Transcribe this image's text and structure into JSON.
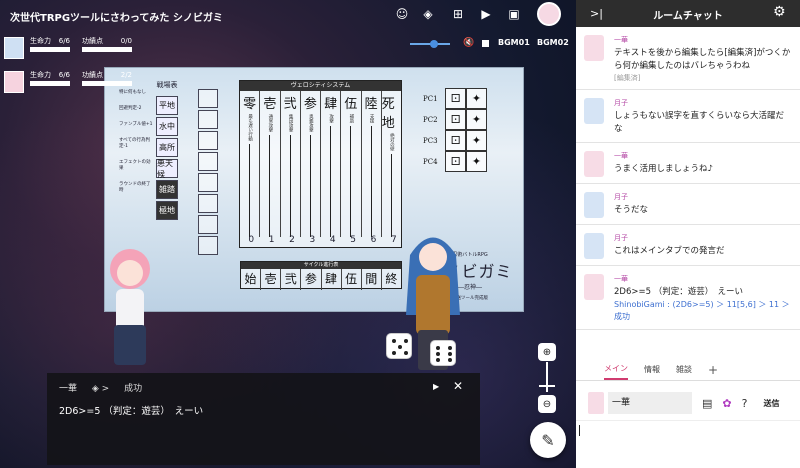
{
  "room": {
    "title": "次世代TRPGツールにさわってみた シノビガミ"
  },
  "statuses": [
    {
      "label1": "生命力",
      "value1": "6/6",
      "label2": "功績点",
      "value2": "0/0"
    },
    {
      "label1": "生命力",
      "value1": "6/6",
      "label2": "功績点",
      "value2": "2/2"
    }
  ],
  "bgm": {
    "track1": "BGM01",
    "track2": "BGM02"
  },
  "board": {
    "terrain_header": "戦場表",
    "terrain": [
      "平地",
      "水中",
      "高所",
      "悪天候",
      "雑踏",
      "極地"
    ],
    "notes": [
      "特に何もなし",
      "回避判定-2",
      "ファンブル値+1",
      "すべての行為判定-1",
      "エフェクトの効果",
      "ラウンドの終了時"
    ],
    "velocity_title": "ヴェロシティシステム",
    "velocity": [
      {
        "big": "零",
        "sm": "最も遅い行動"
      },
      {
        "big": "壱",
        "sm": "通常攻撃"
      },
      {
        "big": "弐",
        "sm": "集団攻撃"
      },
      {
        "big": "参",
        "sm": "奥義攻撃"
      },
      {
        "big": "肆",
        "sm": "攻撃"
      },
      {
        "big": "伍",
        "sm": "補助"
      },
      {
        "big": "陸",
        "sm": "支援"
      },
      {
        "big": "死地",
        "sm": "絶対の壁"
      }
    ],
    "velocity_numbers": [
      "0",
      "1",
      "2",
      "3",
      "4",
      "5",
      "6",
      "7"
    ],
    "cycle_title": "サイクル進行表",
    "cycle": [
      "始",
      "壱",
      "弐",
      "参",
      "肆",
      "伍",
      "間",
      "終"
    ],
    "pc_rows": [
      "PC1",
      "PC2",
      "PC3",
      "PC4"
    ],
    "logo_line1": "忍術バトルRPG",
    "logo_line2": "シノビガミ",
    "logo_line3": "―忍神―",
    "logo_line4": "輸送ツール完成版"
  },
  "dice_log": {
    "name": "一華",
    "result": "成功",
    "message": "2D6>=5 （判定：遊芸）　えーい"
  },
  "chat": {
    "title": "ルームチャット",
    "messages": [
      {
        "name": "一華",
        "text": "テキストを後から編集したら[編集済]がつくから何か編集したのはバレちゃうわね",
        "edited": "[編集済]",
        "avatar": "p"
      },
      {
        "name": "月子",
        "text": "しょうもない誤字を直すくらいなら大活躍だな",
        "avatar": "b"
      },
      {
        "name": "一華",
        "text": "うまく活用しましょうね♪",
        "avatar": "p"
      },
      {
        "name": "月子",
        "text": "そうだな",
        "avatar": "b"
      },
      {
        "name": "月子",
        "text": "これはメインタブでの発言だ",
        "avatar": "b"
      },
      {
        "name": "一華",
        "text": "2D6>=5 （判定：遊芸）　えーい",
        "result": "ShinobiGami : (2D6>=5) ＞ 11[5,6] ＞ 11 ＞ 成功",
        "avatar": "p"
      }
    ],
    "tabs": [
      "メイン",
      "情報",
      "雑談"
    ],
    "input_name": "一華",
    "send_label": "送信"
  }
}
